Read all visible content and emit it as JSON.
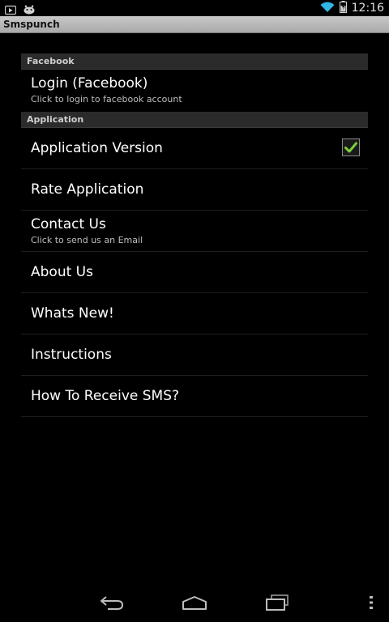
{
  "status_bar": {
    "time": "12:16",
    "icons": [
      "play-store-icon",
      "android-icon",
      "wifi-icon",
      "battery-icon"
    ]
  },
  "title_bar": {
    "title": "Smspunch"
  },
  "sections": {
    "facebook": {
      "header": "Facebook",
      "login": {
        "title": "Login (Facebook)",
        "summary": "Click to login to facebook account"
      }
    },
    "application": {
      "header": "Application",
      "version": {
        "title": "Application Version",
        "checked": true
      },
      "rate": {
        "title": "Rate Application"
      },
      "contact": {
        "title": "Contact Us",
        "summary": "Click to send us an Email"
      },
      "about": {
        "title": "About Us"
      },
      "whats_new": {
        "title": "Whats New!"
      },
      "instructions": {
        "title": "Instructions"
      },
      "receive_sms": {
        "title": "How To Receive SMS?"
      }
    }
  },
  "nav_bar": {
    "icons": [
      "back-icon",
      "home-icon",
      "recent-apps-icon",
      "overflow-menu-icon"
    ]
  },
  "colors": {
    "background": "#000000",
    "section_header_bg": "#2b2b2b",
    "title_bar_bg": "#bdbdbd",
    "check_accent": "#7fd13b",
    "wifi_accent": "#33b5e5"
  }
}
